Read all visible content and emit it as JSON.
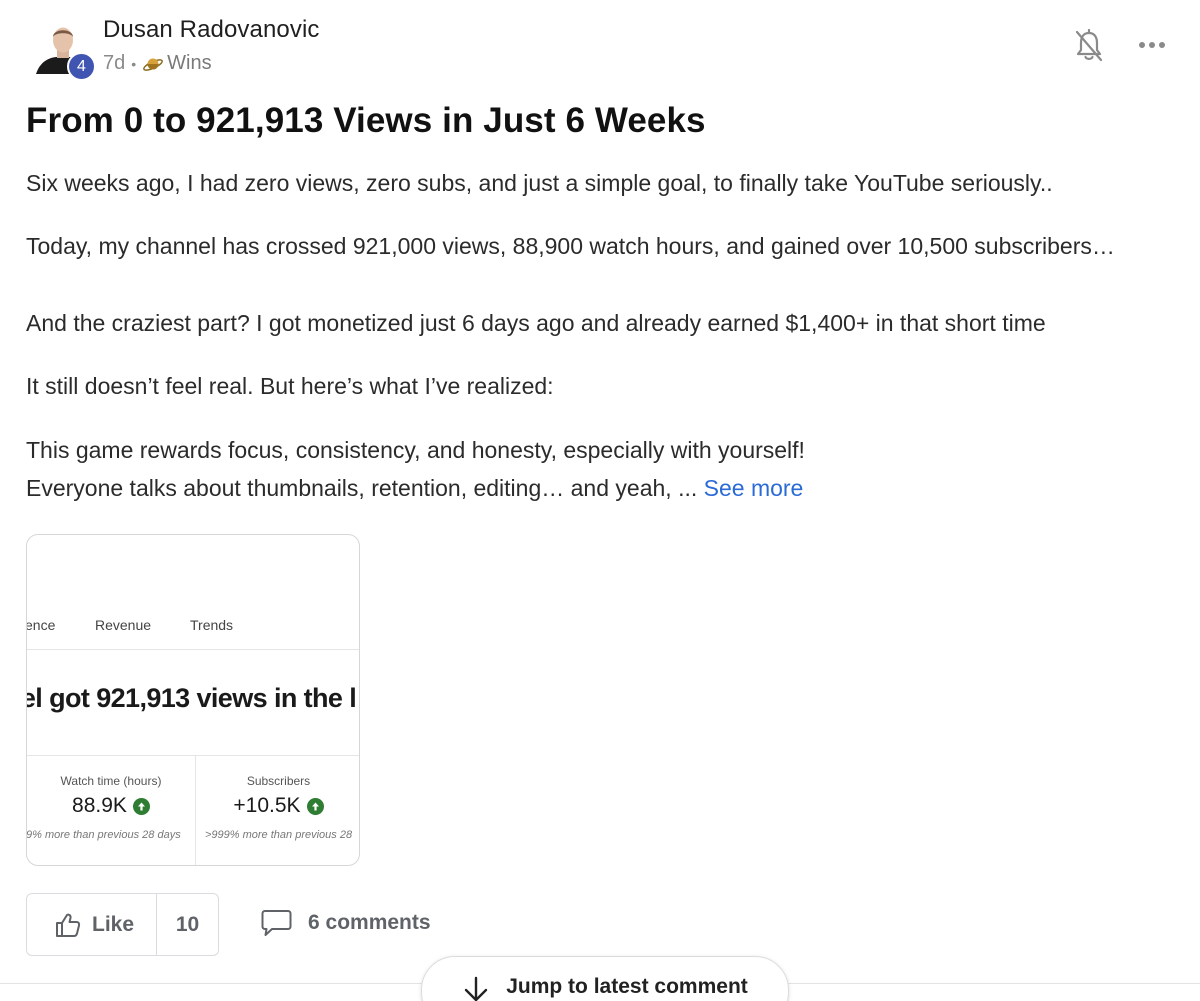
{
  "post": {
    "author": "Dusan Radovanovic",
    "level": "4",
    "time_ago": "7d",
    "separator": "•",
    "category": "Wins",
    "title": "From 0 to 921,913 Views in Just 6 Weeks",
    "paragraphs": [
      "Six weeks ago, I had zero views, zero subs, and just a simple goal, to finally take YouTube seriously..",
      "Today, my channel has crossed 921,000 views, 88,900 watch hours, and gained over 10,500 subscribers…",
      "And the craziest part? I got monetized just 6 days ago and already earned $1,400+ in that short time",
      "It still doesn’t feel real. But here’s what I’ve realized:",
      "This game rewards focus, consistency, and honesty, especially with yourself!",
      "Everyone talks about thumbnails, retention, editing… and yeah, ..."
    ],
    "see_more": "See more"
  },
  "attachment": {
    "tabs": [
      "ence",
      "Revenue",
      "Trends"
    ],
    "headline": "nel got 921,913 views in the l",
    "stats": [
      {
        "label": "Watch time (hours)",
        "value": "88.9K",
        "note": "9% more than previous 28 days"
      },
      {
        "label": "Subscribers",
        "value": "+10.5K",
        "note": ">999% more than previous 28"
      }
    ]
  },
  "actions": {
    "like_label": "Like",
    "like_count": "10",
    "comments_label": "6 comments",
    "jump_label": "Jump to latest comment"
  },
  "colors": {
    "link": "#2b6bd6",
    "badge": "#4054b2",
    "stat_up": "#2e7d32"
  },
  "icons": [
    "bell-off-icon",
    "more-icon",
    "thumbs-up-icon",
    "comment-icon",
    "arrow-down-icon",
    "up-arrow-icon",
    "category-icon"
  ]
}
